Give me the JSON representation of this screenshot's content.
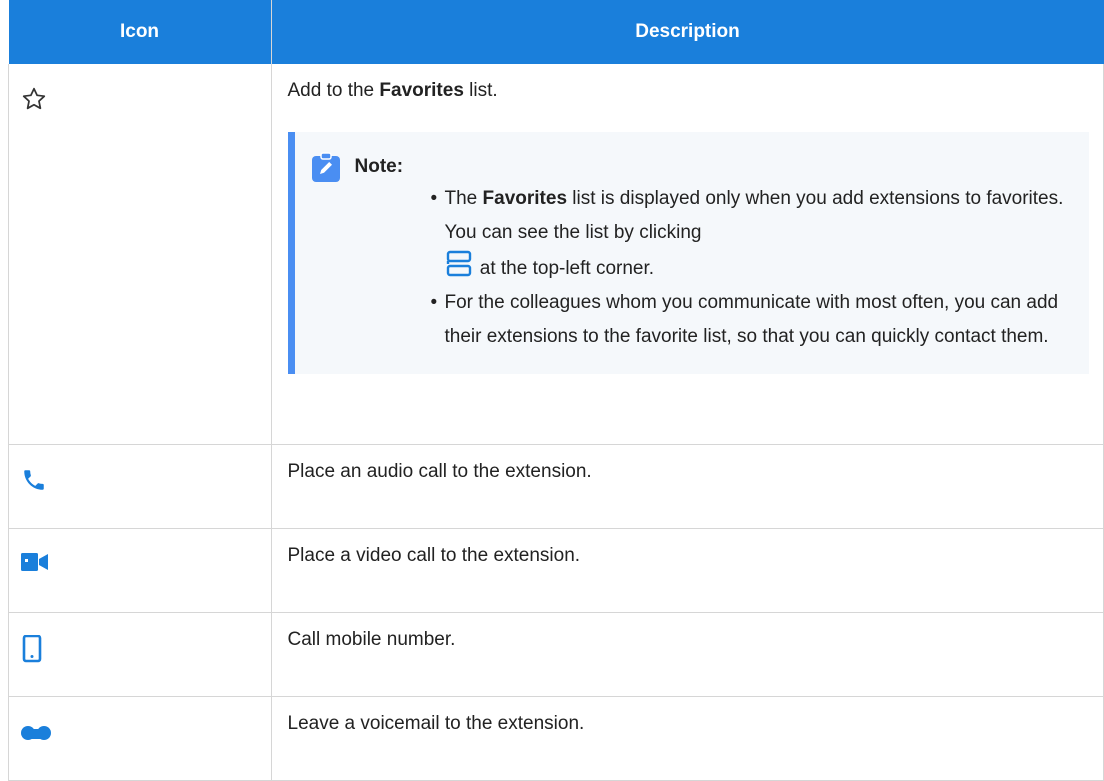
{
  "header": {
    "col_icon": "Icon",
    "col_description": "Description"
  },
  "rows": [
    {
      "icon": "star-outline-icon",
      "desc_pre": "Add to the ",
      "desc_bold": "Favorites",
      "desc_post": " list.",
      "note": {
        "title": "Note:",
        "items": [
          {
            "pre": "The ",
            "bold": "Favorites",
            "mid": " list is displayed only when you add extensions to favorites. You can see the list by clicking ",
            "icon": "sidebar-list-icon",
            "post": " at the top-left corner."
          },
          {
            "text": "For the colleagues whom you communicate with most often, you can add their extensions to the favorite list, so that you can quickly contact them."
          }
        ]
      }
    },
    {
      "icon": "phone-icon",
      "desc": "Place an audio call to the extension."
    },
    {
      "icon": "video-camera-icon",
      "desc": "Place a video call to the extension."
    },
    {
      "icon": "mobile-phone-icon",
      "desc": "Call mobile number."
    },
    {
      "icon": "voicemail-icon",
      "desc": "Leave a voicemail to the extension."
    }
  ],
  "colors": {
    "header_bg": "#1a7fdb",
    "icon_blue": "#1a7fdb",
    "note_border": "#4a8ef2",
    "note_bg": "#f5f8fb"
  }
}
